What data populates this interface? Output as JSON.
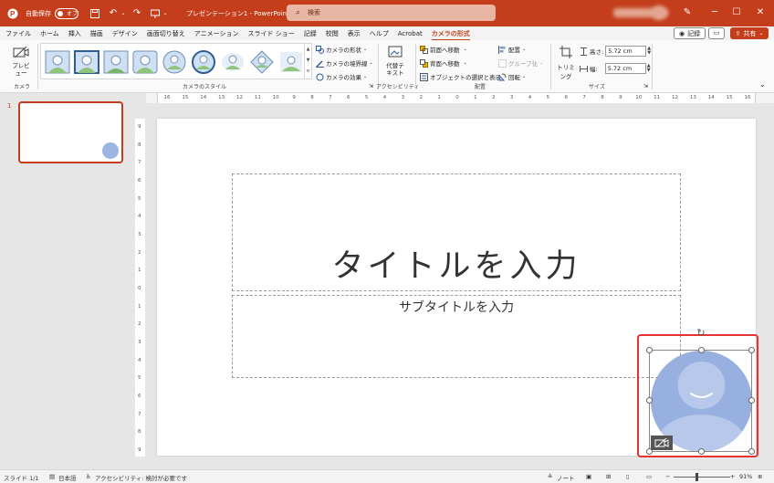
{
  "titlebar": {
    "app_icon": "powerpoint-logo",
    "autosave_label": "自動保存",
    "autosave_state": "オフ",
    "doc_title": "プレゼンテーション1 - PowerPoint",
    "search_placeholder": "検索",
    "minimize": "─",
    "maximize": "☐",
    "close": "✕"
  },
  "tabs": [
    "ファイル",
    "ホーム",
    "挿入",
    "描画",
    "デザイン",
    "画面切り替え",
    "アニメーション",
    "スライド ショー",
    "記録",
    "校閲",
    "表示",
    "ヘルプ",
    "Acrobat",
    "カメラの形式"
  ],
  "active_tab": "カメラの形式",
  "tabbar_right": {
    "record_label": "記録",
    "share_label": "共有"
  },
  "ribbon": {
    "camera_group": {
      "preview_label": "プレビュー",
      "label": "カメラ"
    },
    "styles_group": {
      "label": "カメラのスタイル",
      "shape": "カメラの形状",
      "border": "カメラの境界線",
      "effects": "カメラの効果"
    },
    "accessibility_group": {
      "alt_text": "代替テキスト",
      "label": "アクセシビリティ"
    },
    "arrange_group": {
      "label": "配置",
      "bring_forward": "前面へ移動",
      "send_backward": "背面へ移動",
      "selection_pane": "オブジェクトの選択と表示",
      "align": "配置",
      "group": "グループ化",
      "rotate": "回転"
    },
    "size_group": {
      "label": "サイズ",
      "crop": "トリミング",
      "height_label": "高さ:",
      "height_value": "5.72 cm",
      "width_label": "幅:",
      "width_value": "5.72 cm"
    }
  },
  "thumbnails": {
    "slide_number": "1"
  },
  "ruler": {
    "h_labels": [
      "16",
      "15",
      "14",
      "13",
      "12",
      "11",
      "10",
      "9",
      "8",
      "7",
      "6",
      "5",
      "4",
      "3",
      "2",
      "1",
      "0",
      "1",
      "2",
      "3",
      "4",
      "5",
      "6",
      "7",
      "8",
      "9",
      "10",
      "11",
      "12",
      "13",
      "14",
      "15",
      "16"
    ],
    "v_labels": [
      "9",
      "8",
      "7",
      "6",
      "5",
      "4",
      "3",
      "2",
      "1",
      "0",
      "1",
      "2",
      "3",
      "4",
      "5",
      "6",
      "7",
      "8",
      "9"
    ]
  },
  "slide": {
    "title_placeholder": "タイトルを入力",
    "subtitle_placeholder": "サブタイトルを入力"
  },
  "statusbar": {
    "slide_info": "スライド 1/1",
    "language": "日本語",
    "accessibility": "アクセシビリティ: 検討が必要です",
    "notes": "ノート",
    "zoom": "91%"
  },
  "colors": {
    "accent": "#c43e1c",
    "camera_fill": "#98b0df",
    "selection_outline": "#e63232"
  }
}
